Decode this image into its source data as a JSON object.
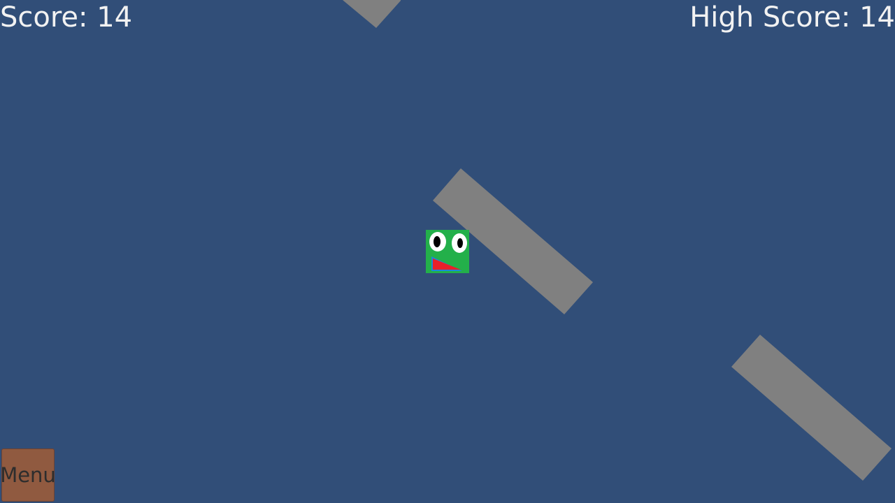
{
  "hud": {
    "score_text": "Score: 14",
    "high_score_text": "High Score: 14",
    "text_color": "#f2f2f2"
  },
  "menu": {
    "label": "Menu",
    "color": "#905a40"
  },
  "scene": {
    "background_color": "#314e78",
    "obstacle_color": "#808080",
    "player": {
      "body_color": "#23b04a",
      "eye_color": "#ffffff",
      "pupil_color": "#000000",
      "mouth_color": "#e8202a",
      "mouth_lower_color": "#1e88d8"
    }
  }
}
